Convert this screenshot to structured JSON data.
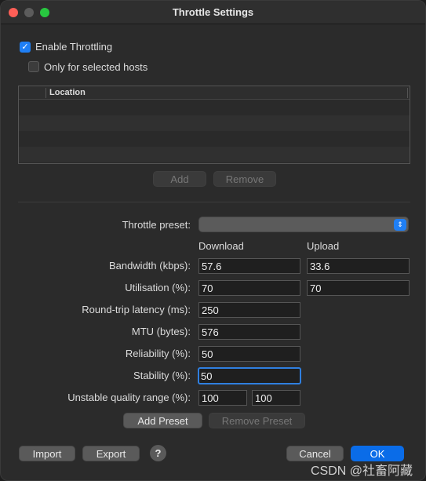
{
  "window": {
    "title": "Throttle Settings"
  },
  "throttling": {
    "enable_label": "Enable Throttling",
    "enable_checked": true,
    "selected_hosts_label": "Only for selected hosts",
    "selected_hosts_checked": false
  },
  "hosts_table": {
    "column_header": "Location",
    "add_label": "Add",
    "remove_label": "Remove"
  },
  "preset": {
    "label": "Throttle preset:",
    "value": "",
    "download_header": "Download",
    "upload_header": "Upload"
  },
  "fields": {
    "bandwidth_label": "Bandwidth (kbps):",
    "bandwidth_download": "57.6",
    "bandwidth_upload": "33.6",
    "utilisation_label": "Utilisation (%):",
    "utilisation_download": "70",
    "utilisation_upload": "70",
    "latency_label": "Round-trip latency (ms):",
    "latency_value": "250",
    "mtu_label": "MTU (bytes):",
    "mtu_value": "576",
    "reliability_label": "Reliability (%):",
    "reliability_value": "50",
    "stability_label": "Stability (%):",
    "stability_value": "50",
    "unstable_label": "Unstable quality range (%):",
    "unstable_min": "100",
    "unstable_max": "100"
  },
  "preset_buttons": {
    "add_label": "Add Preset",
    "remove_label": "Remove Preset"
  },
  "footer": {
    "import_label": "Import",
    "export_label": "Export",
    "help_label": "?",
    "cancel_label": "Cancel",
    "ok_label": "OK"
  },
  "watermark": "CSDN @社畜阿藏"
}
